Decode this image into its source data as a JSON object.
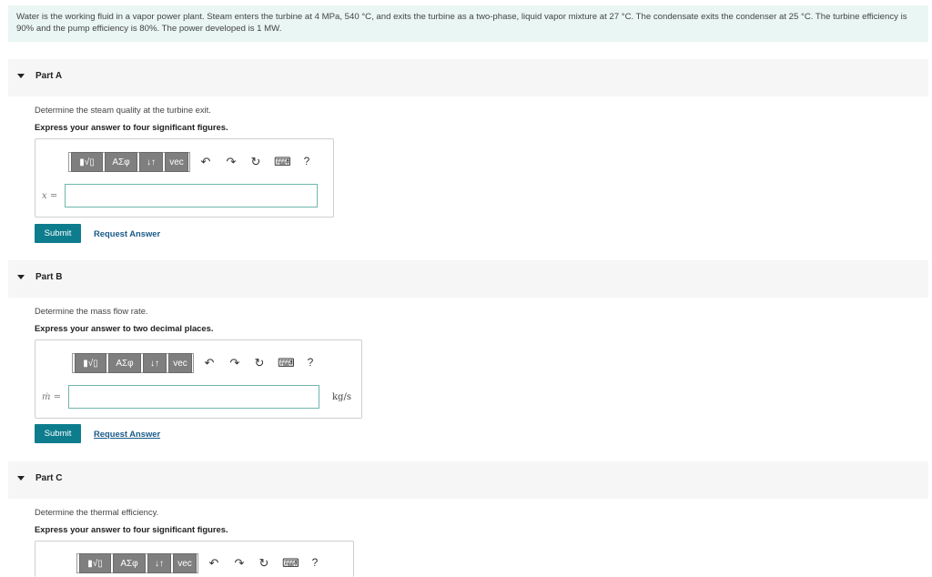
{
  "problem": {
    "text": "Water is the working fluid in a vapor power plant. Steam enters the turbine at 4 MPa, 540 °C, and exits the turbine as a two-phase, liquid vapor mixture at 27 °C. The condensate exits the condenser at 25 °C. The turbine efficiency is 90% and the pump efficiency is 80%. The power developed is 1 MW."
  },
  "toolbar": {
    "templates": "▮√▯",
    "greek": "ΑΣφ",
    "arrows": "↓↑",
    "vec": "vec",
    "undo": "↶",
    "redo": "↷",
    "reset": "↻",
    "keyboard": "⌨",
    "help": "?"
  },
  "parts": [
    {
      "label": "Part A",
      "question": "Determine the steam quality at the turbine exit.",
      "instruction": "Express your answer to four significant figures.",
      "variable": "x =",
      "value": "",
      "unit": "",
      "submit": "Submit",
      "request": "Request Answer"
    },
    {
      "label": "Part B",
      "question": "Determine the mass flow rate.",
      "instruction": "Express your answer to two decimal places.",
      "variable": "ṁ =",
      "value": "",
      "unit": "kg/s",
      "submit": "Submit",
      "request": "Request Answer"
    },
    {
      "label": "Part C",
      "question": "Determine the thermal efficiency.",
      "instruction": "Express your answer to four significant figures.",
      "variable": "",
      "value": "",
      "unit": "",
      "submit": "",
      "request": ""
    }
  ]
}
